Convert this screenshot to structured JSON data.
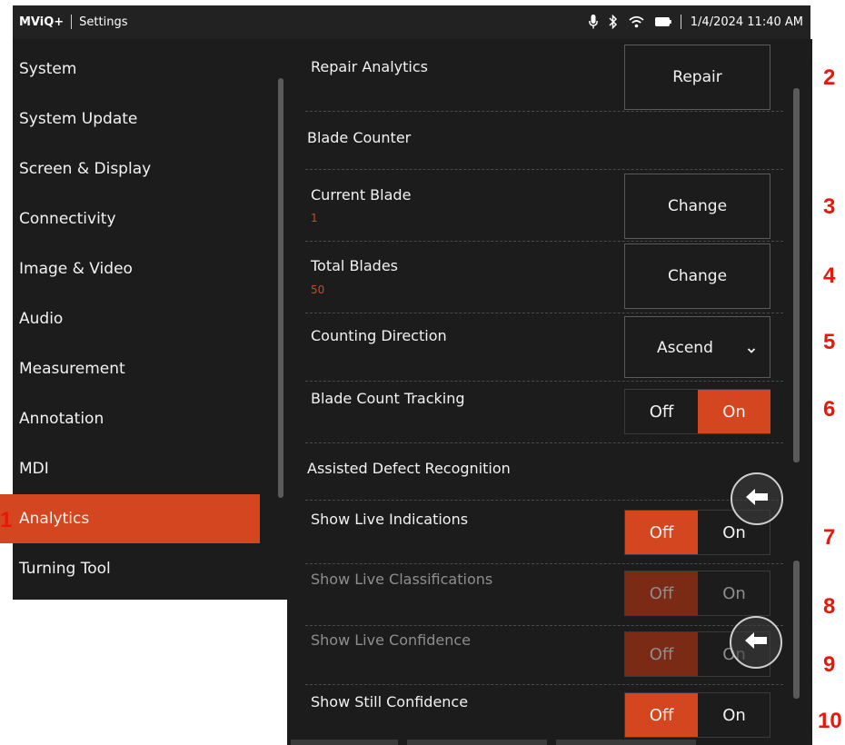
{
  "status_bar": {
    "app_name": "MViQ+",
    "screen_title": "Settings",
    "datetime": "1/4/2024 11:40 AM",
    "icons": [
      "microphone-icon",
      "bluetooth-icon",
      "wifi-icon",
      "battery-icon"
    ]
  },
  "sidebar": {
    "items": [
      {
        "label": "System",
        "active": false
      },
      {
        "label": "System Update",
        "active": false
      },
      {
        "label": "Screen & Display",
        "active": false
      },
      {
        "label": "Connectivity",
        "active": false
      },
      {
        "label": "Image & Video",
        "active": false
      },
      {
        "label": "Audio",
        "active": false
      },
      {
        "label": "Measurement",
        "active": false
      },
      {
        "label": "Annotation",
        "active": false
      },
      {
        "label": "MDI",
        "active": false
      },
      {
        "label": "Analytics",
        "active": true
      },
      {
        "label": "Turning Tool",
        "active": false
      }
    ]
  },
  "settings": {
    "repair_analytics": {
      "label": "Repair Analytics",
      "button": "Repair"
    },
    "blade_counter_header": "Blade Counter",
    "current_blade": {
      "label": "Current Blade",
      "value": "1",
      "button": "Change"
    },
    "total_blades": {
      "label": "Total Blades",
      "value": "50",
      "button": "Change"
    },
    "counting_direction": {
      "label": "Counting Direction",
      "selected": "Ascend"
    },
    "blade_count_tracking": {
      "label": "Blade Count Tracking",
      "off": "Off",
      "on": "On",
      "state": "on"
    },
    "adr_header": "Assisted Defect Recognition",
    "show_live_indications": {
      "label": "Show Live Indications",
      "off": "Off",
      "on": "On",
      "state": "off"
    },
    "show_live_classifications": {
      "label": "Show Live Classifications",
      "off": "Off",
      "on": "On",
      "state": "off",
      "disabled": true
    },
    "show_live_confidence": {
      "label": "Show Live Confidence",
      "off": "Off",
      "on": "On",
      "state": "off",
      "disabled": true
    },
    "show_still_confidence": {
      "label": "Show Still Confidence",
      "off": "Off",
      "on": "On",
      "state": "off"
    }
  },
  "callouts": [
    "1",
    "2",
    "3",
    "4",
    "5",
    "6",
    "7",
    "8",
    "9",
    "10"
  ],
  "colors": {
    "accent": "#d4461f",
    "background": "#1c1c1c",
    "status_bar": "#222222",
    "callout": "#e8170a"
  }
}
